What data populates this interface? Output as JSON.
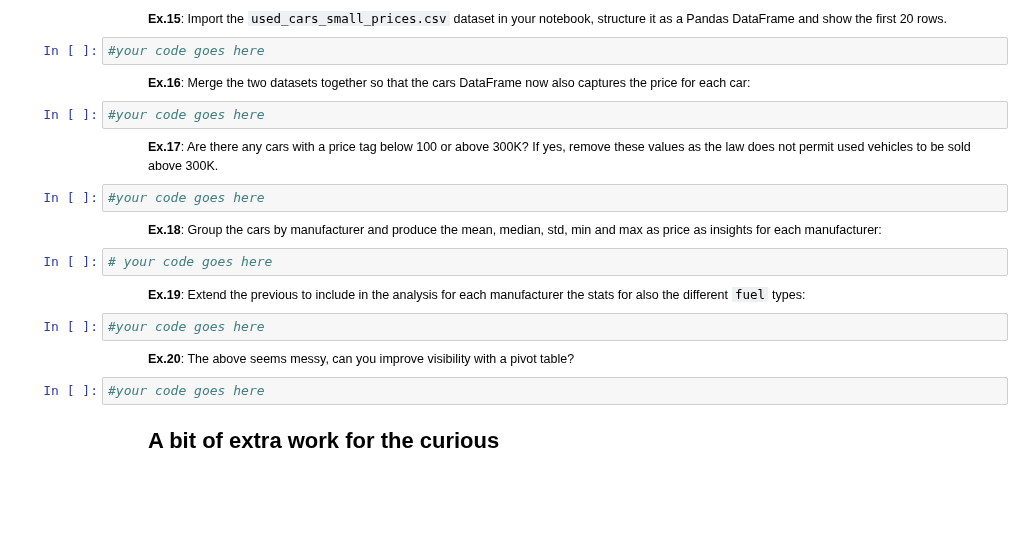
{
  "cells": [
    {
      "kind": "markdown",
      "parts": [
        {
          "kind": "text",
          "text": "**Ex.15**: Import the"
        },
        {
          "kind": "code",
          "text": "used_cars_small_prices.csv"
        },
        {
          "kind": "text",
          "text": "dataset in your notebook, structure it as a Pandas DataFrame and show the first 20 rows."
        }
      ]
    },
    {
      "kind": "code",
      "prompt": "In [ ]:",
      "source": "#your code goes here"
    },
    {
      "kind": "markdown",
      "parts": [
        {
          "kind": "text",
          "text": "**Ex.16**: Merge the two datasets together so that the cars DataFrame now also captures the price for each car:"
        }
      ]
    },
    {
      "kind": "code",
      "prompt": "In [ ]:",
      "source": "#your code goes here"
    },
    {
      "kind": "markdown",
      "parts": [
        {
          "kind": "text",
          "text": "**Ex.17**: Are there any cars with a price tag below 100 or above 300K? If yes, remove these values as the law does not permit used vehicles to be sold above 300K."
        }
      ]
    },
    {
      "kind": "code",
      "prompt": "In [ ]:",
      "source": "#your code goes here"
    },
    {
      "kind": "markdown",
      "parts": [
        {
          "kind": "text",
          "text": "**Ex.18**: Group the cars by manufacturer and produce the mean, median, std, min and max as price as insights for each manufacturer:"
        }
      ]
    },
    {
      "kind": "code",
      "prompt": "In [ ]:",
      "source": "# your code goes here"
    },
    {
      "kind": "markdown",
      "parts": [
        {
          "kind": "text",
          "text": "**Ex.19**: Extend the previous to include in the analysis for each manufacturer the stats for also the different"
        },
        {
          "kind": "code",
          "text": "fuel"
        },
        {
          "kind": "text",
          "text": "types:"
        }
      ]
    },
    {
      "kind": "code",
      "prompt": "In [ ]:",
      "source": "#your code goes here"
    },
    {
      "kind": "markdown",
      "parts": [
        {
          "kind": "text",
          "text": "**Ex.20**: The above seems messy, can you improve visibility with a pivot table?"
        }
      ]
    },
    {
      "kind": "code",
      "prompt": "In [ ]:",
      "source": "#your code goes here"
    },
    {
      "kind": "heading",
      "text": "A bit of extra work for the curious"
    }
  ]
}
